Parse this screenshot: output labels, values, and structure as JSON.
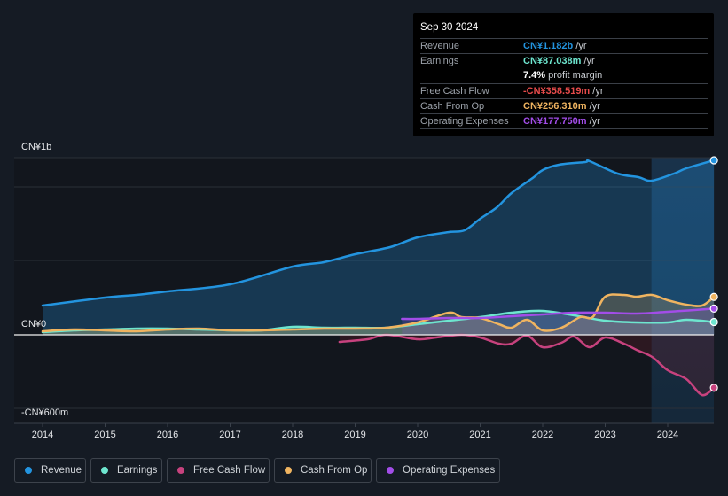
{
  "tooltip": {
    "date": "Sep 30 2024",
    "rows": [
      {
        "label": "Revenue",
        "value": "CN¥1.182b",
        "unit": " /yr",
        "color": "#2394df"
      },
      {
        "label": "Earnings",
        "value": "CN¥87.038m",
        "unit": " /yr",
        "color": "#6ee6cf"
      },
      {
        "label": "",
        "value": "7.4%",
        "unit": " profit margin",
        "color": "#ffffff"
      },
      {
        "label": "Free Cash Flow",
        "value": "-CN¥358.519m",
        "unit": " /yr",
        "color": "#e64b4b"
      },
      {
        "label": "Cash From Op",
        "value": "CN¥256.310m",
        "unit": " /yr",
        "color": "#f0b460"
      },
      {
        "label": "Operating Expenses",
        "value": "CN¥177.750m",
        "unit": " /yr",
        "color": "#a24de8"
      }
    ]
  },
  "legend": [
    {
      "label": "Revenue",
      "color": "#2394df"
    },
    {
      "label": "Earnings",
      "color": "#6ee6cf"
    },
    {
      "label": "Free Cash Flow",
      "color": "#c7427e"
    },
    {
      "label": "Cash From Op",
      "color": "#f0b460"
    },
    {
      "label": "Operating Expenses",
      "color": "#a24de8"
    }
  ],
  "chart_data": {
    "type": "line",
    "title": "",
    "xlabel": "",
    "ylabel": "",
    "currency": "CN¥",
    "unit": "millions",
    "y_tick_labels": [
      "CN¥1b",
      "CN¥0",
      "-CN¥600m"
    ],
    "x_tick_labels": [
      "2014",
      "2015",
      "2016",
      "2017",
      "2018",
      "2019",
      "2020",
      "2021",
      "2022",
      "2023",
      "2024"
    ],
    "xlim": [
      2013.55,
      2024.74
    ],
    "ylim": [
      -700,
      1200
    ],
    "highlight_from": 2023.74,
    "legend_position": "bottom",
    "series": [
      {
        "name": "Revenue",
        "color": "#2394df",
        "end_value": 1182,
        "points": [
          [
            2014,
            198
          ],
          [
            2015,
            252
          ],
          [
            2015.5,
            270
          ],
          [
            2016,
            294
          ],
          [
            2017,
            342
          ],
          [
            2018,
            462
          ],
          [
            2018.5,
            492
          ],
          [
            2019,
            546
          ],
          [
            2019.56,
            594
          ],
          [
            2020,
            660
          ],
          [
            2020.5,
            696
          ],
          [
            2020.75,
            708
          ],
          [
            2021,
            786
          ],
          [
            2021.27,
            864
          ],
          [
            2021.5,
            960
          ],
          [
            2021.84,
            1062
          ],
          [
            2022,
            1116
          ],
          [
            2022.26,
            1152
          ],
          [
            2022.68,
            1170
          ],
          [
            2022.75,
            1176
          ],
          [
            2023.2,
            1092
          ],
          [
            2023.53,
            1068
          ],
          [
            2023.74,
            1044
          ],
          [
            2024.1,
            1092
          ],
          [
            2024.3,
            1128
          ],
          [
            2024.74,
            1182
          ]
        ]
      },
      {
        "name": "Earnings",
        "color": "#6ee6cf",
        "end_value": 87,
        "points": [
          [
            2014,
            18
          ],
          [
            2014.5,
            30
          ],
          [
            2015,
            36
          ],
          [
            2015.5,
            42
          ],
          [
            2016,
            42
          ],
          [
            2016.5,
            36
          ],
          [
            2017,
            30
          ],
          [
            2017.5,
            30
          ],
          [
            2018,
            54
          ],
          [
            2018.5,
            48
          ],
          [
            2019,
            48
          ],
          [
            2019.5,
            48
          ],
          [
            2020,
            72
          ],
          [
            2020.5,
            96
          ],
          [
            2021,
            120
          ],
          [
            2021.5,
            150
          ],
          [
            2022,
            162
          ],
          [
            2022.5,
            132
          ],
          [
            2023,
            96
          ],
          [
            2023.5,
            84
          ],
          [
            2024,
            84
          ],
          [
            2024.3,
            102
          ],
          [
            2024.74,
            87
          ]
        ]
      },
      {
        "name": "Free Cash Flow",
        "color": "#c7427e",
        "end_value": -358.5,
        "points": [
          [
            2018.75,
            -48
          ],
          [
            2019.2,
            -30
          ],
          [
            2019.5,
            0
          ],
          [
            2020,
            -30
          ],
          [
            2020.3,
            -18
          ],
          [
            2020.7,
            0
          ],
          [
            2021,
            -18
          ],
          [
            2021.3,
            -60
          ],
          [
            2021.5,
            -60
          ],
          [
            2021.75,
            -6
          ],
          [
            2022,
            -84
          ],
          [
            2022.3,
            -54
          ],
          [
            2022.5,
            -12
          ],
          [
            2022.75,
            -84
          ],
          [
            2023,
            -18
          ],
          [
            2023.3,
            -60
          ],
          [
            2023.5,
            -102
          ],
          [
            2023.75,
            -150
          ],
          [
            2024,
            -240
          ],
          [
            2024.3,
            -300
          ],
          [
            2024.55,
            -408
          ],
          [
            2024.74,
            -358.5
          ]
        ]
      },
      {
        "name": "Cash From Op",
        "color": "#f0b460",
        "end_value": 256.3,
        "points": [
          [
            2014,
            24
          ],
          [
            2014.5,
            36
          ],
          [
            2015,
            30
          ],
          [
            2015.5,
            24
          ],
          [
            2016,
            36
          ],
          [
            2016.5,
            42
          ],
          [
            2017,
            30
          ],
          [
            2017.5,
            30
          ],
          [
            2018,
            36
          ],
          [
            2018.5,
            42
          ],
          [
            2019,
            42
          ],
          [
            2019.5,
            48
          ],
          [
            2020,
            84
          ],
          [
            2020.5,
            150
          ],
          [
            2020.7,
            120
          ],
          [
            2021,
            114
          ],
          [
            2021.3,
            72
          ],
          [
            2021.5,
            48
          ],
          [
            2021.75,
            102
          ],
          [
            2022,
            30
          ],
          [
            2022.3,
            48
          ],
          [
            2022.6,
            120
          ],
          [
            2022.8,
            120
          ],
          [
            2023,
            258
          ],
          [
            2023.3,
            270
          ],
          [
            2023.5,
            258
          ],
          [
            2023.75,
            270
          ],
          [
            2024,
            234
          ],
          [
            2024.3,
            204
          ],
          [
            2024.55,
            198
          ],
          [
            2024.74,
            256.3
          ]
        ]
      },
      {
        "name": "Operating Expenses",
        "color": "#a24de8",
        "end_value": 177.75,
        "points": [
          [
            2019.75,
            108
          ],
          [
            2020,
            108
          ],
          [
            2020.5,
            114
          ],
          [
            2021,
            114
          ],
          [
            2021.5,
            126
          ],
          [
            2022,
            138
          ],
          [
            2022.5,
            150
          ],
          [
            2023,
            150
          ],
          [
            2023.5,
            144
          ],
          [
            2024,
            156
          ],
          [
            2024.74,
            177.75
          ]
        ]
      }
    ]
  }
}
